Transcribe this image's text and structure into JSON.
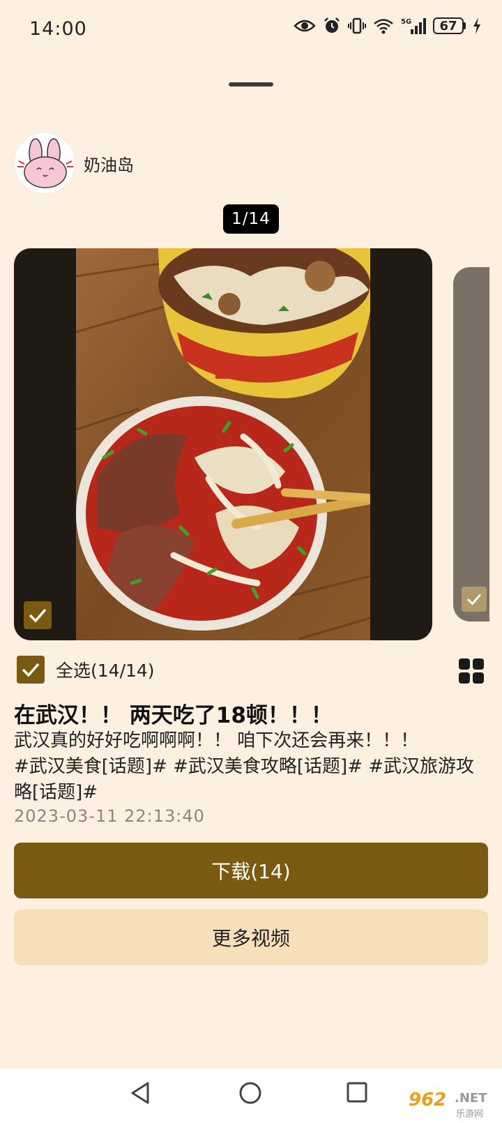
{
  "status_bar": {
    "time": "14:00",
    "battery": "67",
    "network": "5G"
  },
  "author": {
    "name": "奶油岛",
    "avatar_icon": "bunny-avatar"
  },
  "media": {
    "page_indicator": "1/14",
    "selected": true
  },
  "selection": {
    "select_all_label": "全选(14/14)",
    "checked": true
  },
  "post": {
    "title": "在武汉！！ 两天吃了18顿！！！",
    "body_line1": "武汉真的好好吃啊啊啊！！ 咱下次还会再来！！！",
    "body_line2": "#武汉美食[话题]# #武汉美食攻略[话题]# #武汉旅游攻略[话题]#",
    "date": "2023-03-11 22:13:40"
  },
  "actions": {
    "download_label": "下载(14)",
    "more_videos_label": "更多视频"
  },
  "watermark": {
    "number": "962",
    "suffix": ".NET",
    "site": "乐游网"
  },
  "colors": {
    "background": "#fdf0e1",
    "accent": "#7a5a10",
    "secondary_button": "#f7dfba"
  }
}
